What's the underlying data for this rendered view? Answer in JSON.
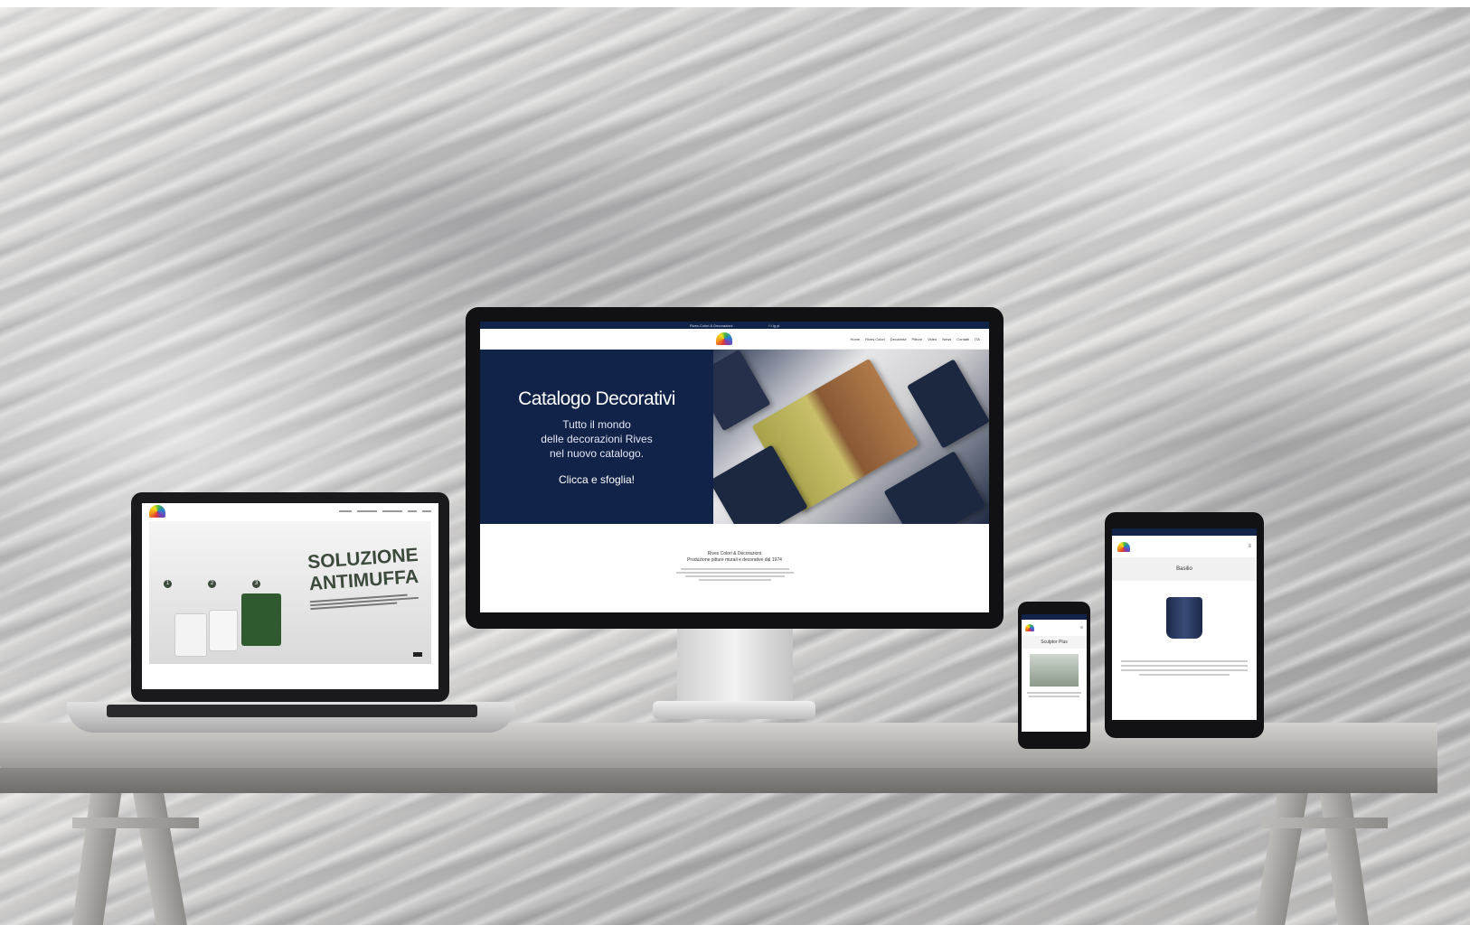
{
  "monitor_site": {
    "topbar_text": "Rives Colori & Decorazioni",
    "nav_links": [
      "Home",
      "Rives Colori",
      "Decorativi",
      "Pitture",
      "Video",
      "News",
      "Contatti",
      "ITA"
    ],
    "hero": {
      "title": "Catalogo Decorativi",
      "text_line1": "Tutto il mondo",
      "text_line2": "delle decorazioni Rives",
      "text_line3": "nel nuovo catalogo.",
      "cta": "Clicca e sfoglia!"
    },
    "footer": {
      "line1": "Rives Colori & Decorazioni",
      "line2": "Produzione pitture murali e decorative dal 1974"
    }
  },
  "laptop_site": {
    "title_line1": "SOLUZIONE",
    "title_line2": "ANTIMUFFA",
    "steps": [
      "1",
      "2",
      "3"
    ]
  },
  "phone_site": {
    "page_title": "Sculptor Plus"
  },
  "tablet_site": {
    "page_title": "Basilio"
  },
  "colors": {
    "brand_navy": "#12234a",
    "desk": "#b5b3b0",
    "device_black": "#121214"
  }
}
